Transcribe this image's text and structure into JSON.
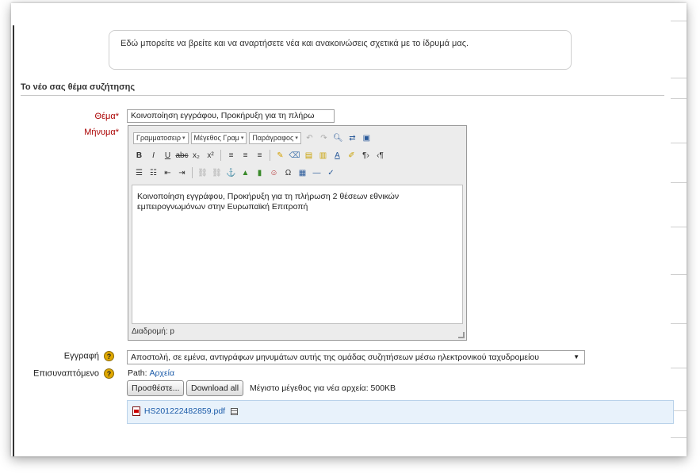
{
  "intro_text": "Εδώ μπορείτε να βρείτε και να αναρτήσετε νέα και ανακοινώσεις σχετικά με το ίδρυμά μας.",
  "section_title": "Το νέο σας θέμα συζήτησης",
  "form": {
    "subject_label": "Θέμα",
    "subject_value": "Κοινοποίηση εγγράφου, Προκήρυξη για τη πλήρω",
    "message_label": "Μήνυμα",
    "required_mark": "*",
    "subscription_label": "Εγγραφή",
    "subscription_value": "Αποστολή, σε εμένα, αντιγράφων μηνυμάτων αυτής της ομάδας συζητήσεων μέσω ηλεκτρονικού ταχυδρομείου",
    "attachment_label": "Επισυναπτόμενο",
    "help_glyph": "?"
  },
  "editor": {
    "font_dropdown": "Γραμματοσειρ",
    "size_dropdown": "Μέγεθος Γραμ",
    "format_dropdown": "Παράγραφος",
    "content": "Κοινοποίηση εγγράφου, Προκήρυξη για τη πλήρωση 2 θέσεων εθνικών εμπειρογνωμόνων στην Ευρωπαϊκή Επιτροπή",
    "path": "Διαδρομή: p"
  },
  "files": {
    "path_label": "Path:",
    "path_link": "Αρχεία",
    "add_button": "Προσθέστε...",
    "download_button": "Download all",
    "max_size": "Μέγιστο μέγεθος για νέα αρχεία: 500KB",
    "file_name": "HS201222482859.pdf"
  },
  "colors": {
    "required_label": "#aa0000",
    "link": "#1a5aa8",
    "help_icon": "#e0a800",
    "file_box_bg": "#e8f2fb"
  }
}
